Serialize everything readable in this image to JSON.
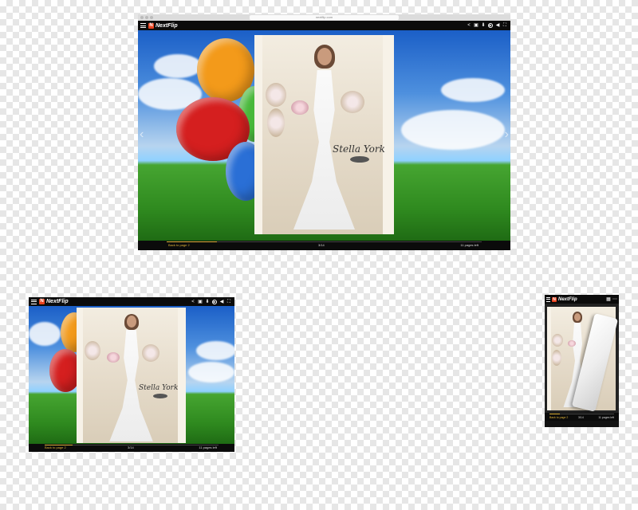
{
  "brand": "NextFlip",
  "logo_letter": "N",
  "url_text": "nextflip.com",
  "toolbar_icons": [
    "share-icon",
    "print-icon",
    "download-icon",
    "play-icon",
    "sound-icon",
    "fullscreen-icon"
  ],
  "phone_toolbar_icons": [
    "grid-icon",
    "more-icon"
  ],
  "publication": {
    "signature": "Stella York",
    "current_page": "3/14",
    "back_label": "Back to page 2",
    "pages_left": "11 pages left",
    "progress": 0.16
  },
  "colors": {
    "accent": "#e0b43a",
    "logo": "#e8431f",
    "bar": "#0b0b0b"
  }
}
